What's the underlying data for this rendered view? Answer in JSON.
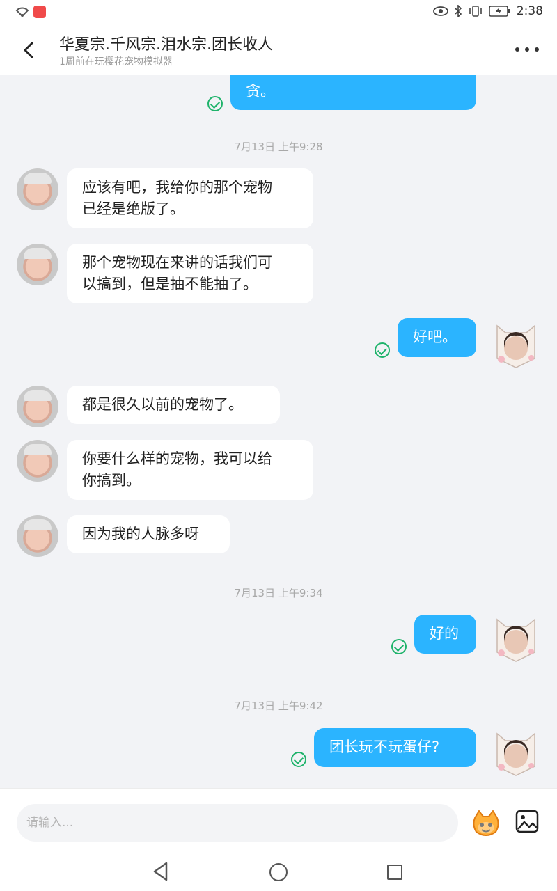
{
  "header": {
    "title": "华夏宗.千风宗.泪水宗.团长收人",
    "subtitle": "1周前在玩樱花宠物模拟器"
  },
  "status_bar": {
    "time": "2:38"
  },
  "chat": {
    "partial_top_message": "贪。",
    "timestamps": [
      "7月13日 上午9:28",
      "7月13日 上午9:34",
      "7月13日 上午9:42"
    ],
    "messages": [
      {
        "side": "left",
        "line1": "应该有吧，我给你的那个宠物",
        "line2": "已经是绝版了。"
      },
      {
        "side": "left",
        "line1": "那个宠物现在来讲的话我们可",
        "line2": "以搞到，但是抽不能抽了。"
      },
      {
        "side": "right",
        "text": "好吧。"
      },
      {
        "side": "left",
        "text": "都是很久以前的宠物了。"
      },
      {
        "side": "left",
        "line1": "你要什么样的宠物，我可以给",
        "line2": "你搞到。"
      },
      {
        "side": "left",
        "text": "因为我的人脉多呀"
      },
      {
        "side": "right",
        "text": "好的"
      },
      {
        "side": "right",
        "text": "团长玩不玩蛋仔?"
      }
    ]
  },
  "input": {
    "placeholder": "请输入..."
  },
  "colors": {
    "accent": "#2bb4ff",
    "read_check": "#1fb36b",
    "background": "#f2f3f6"
  }
}
